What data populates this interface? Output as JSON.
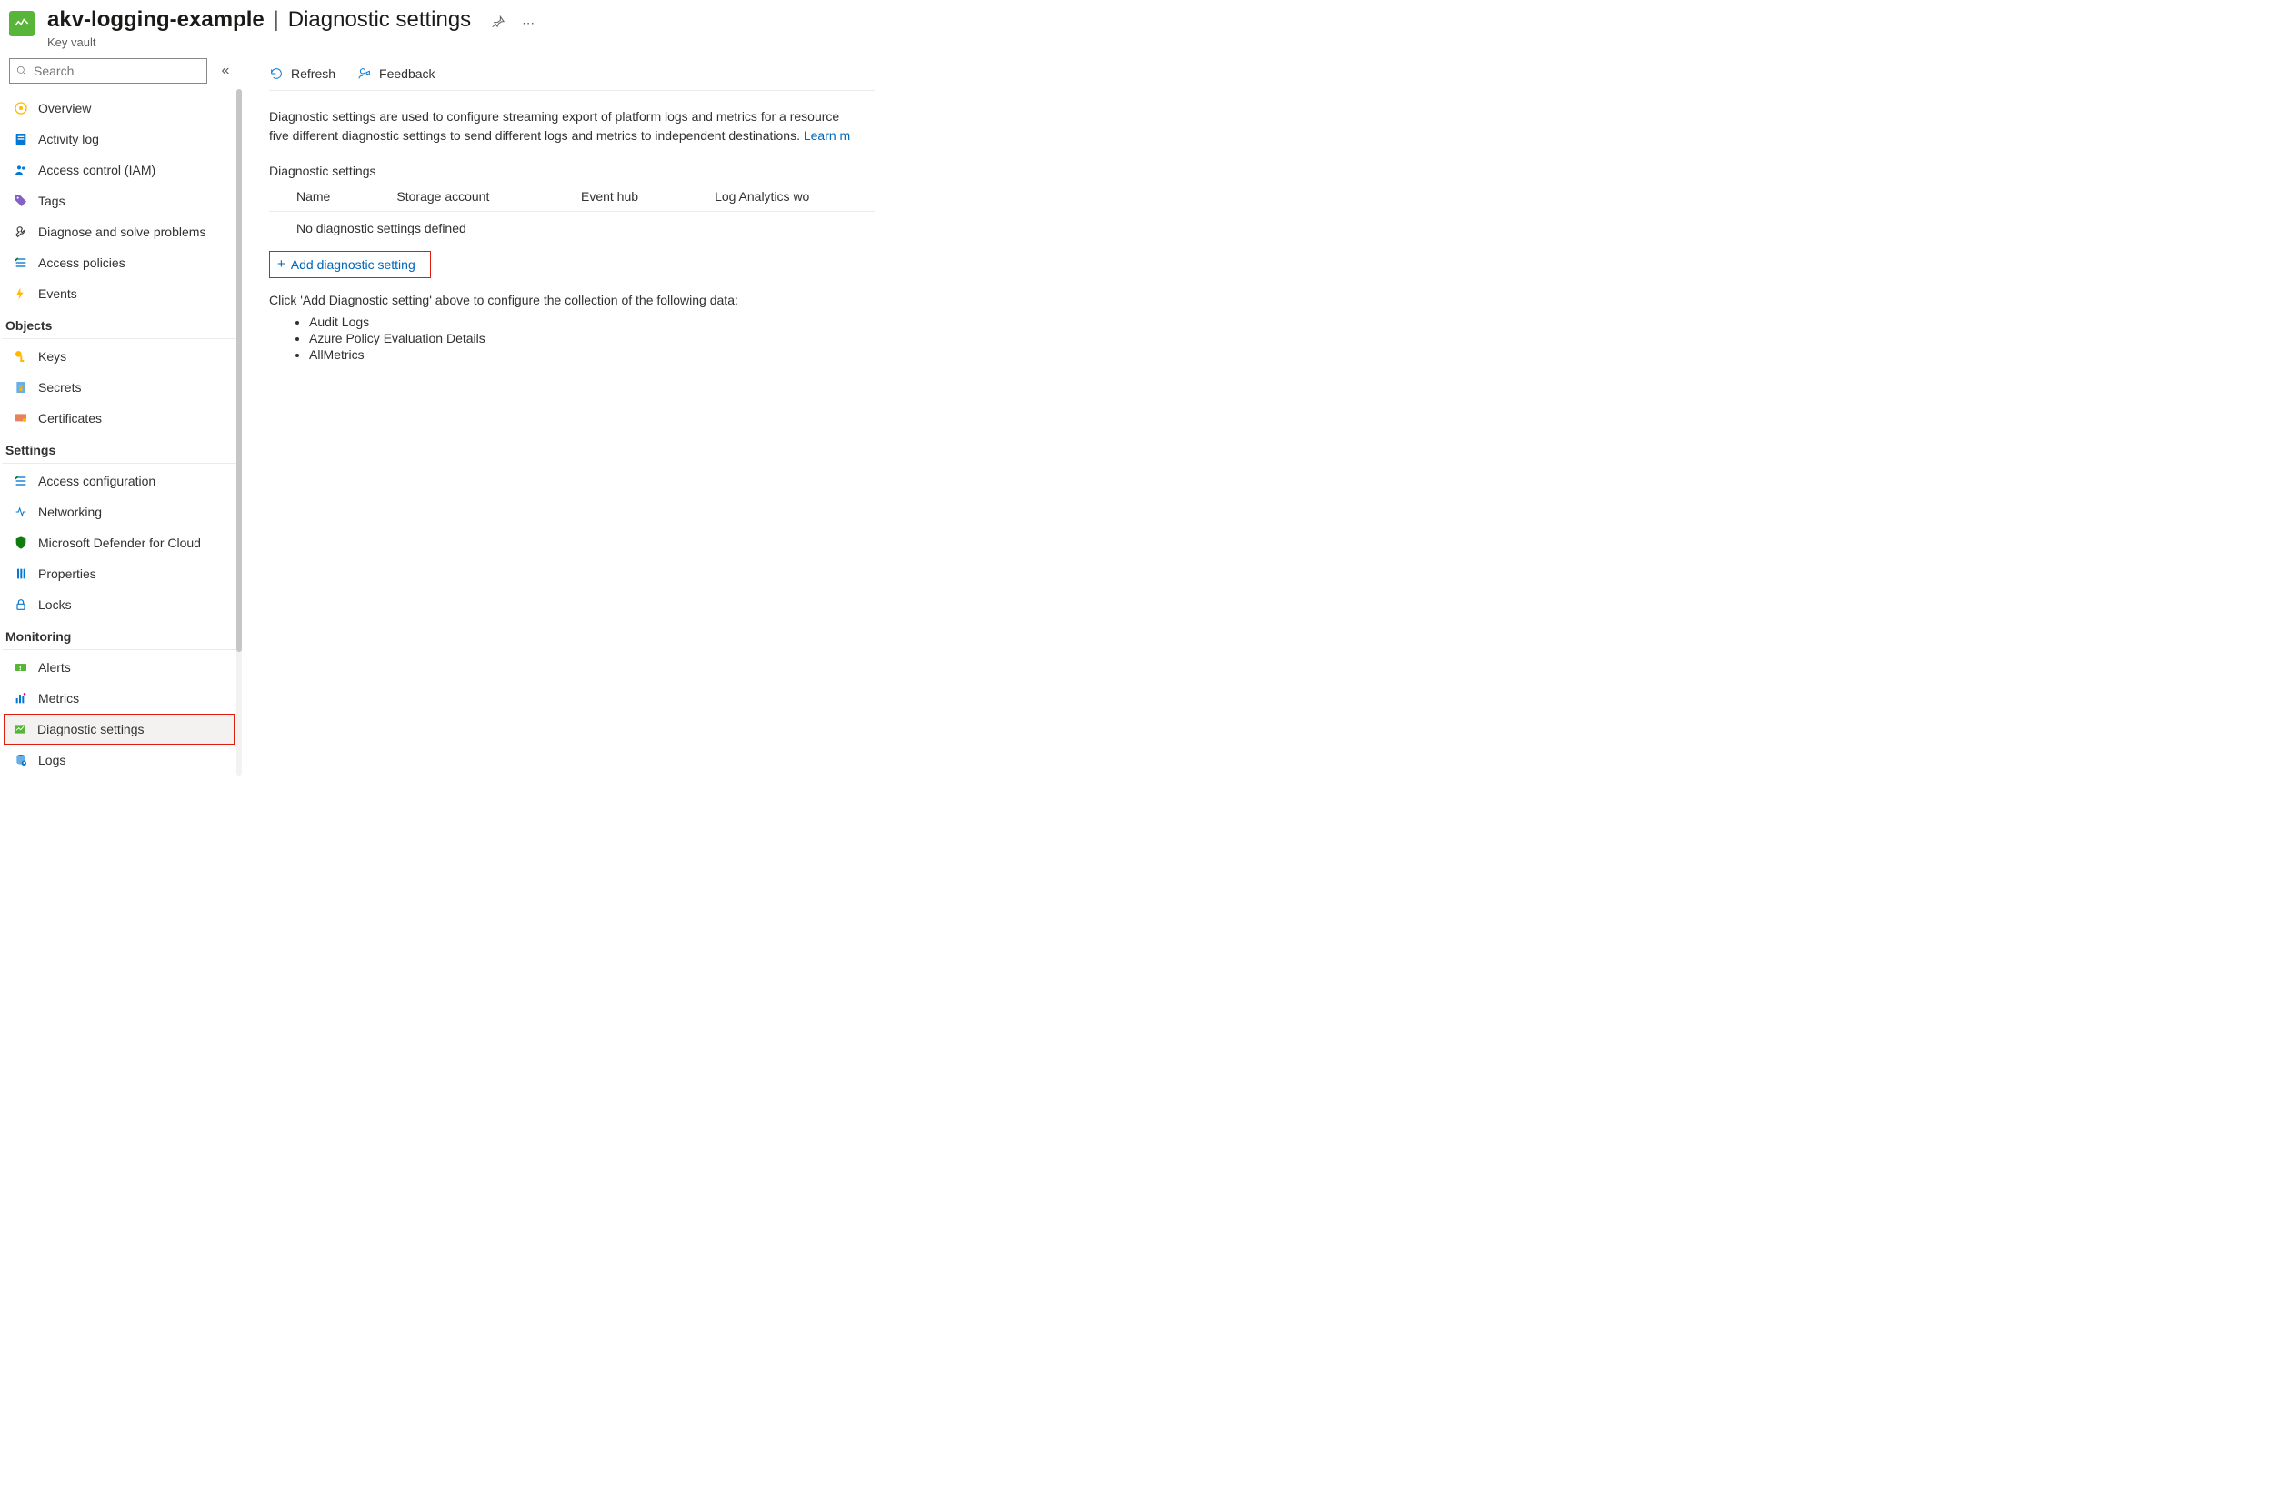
{
  "header": {
    "resource_name": "akv-logging-example",
    "page_title": "Diagnostic settings",
    "resource_type": "Key vault"
  },
  "search": {
    "placeholder": "Search"
  },
  "nav": {
    "top_items": [
      {
        "id": "overview",
        "label": "Overview"
      },
      {
        "id": "activity-log",
        "label": "Activity log"
      },
      {
        "id": "access-control",
        "label": "Access control (IAM)"
      },
      {
        "id": "tags",
        "label": "Tags"
      },
      {
        "id": "diagnose-solve",
        "label": "Diagnose and solve problems"
      },
      {
        "id": "access-policies",
        "label": "Access policies"
      },
      {
        "id": "events",
        "label": "Events"
      }
    ],
    "objects_header": "Objects",
    "objects_items": [
      {
        "id": "keys",
        "label": "Keys"
      },
      {
        "id": "secrets",
        "label": "Secrets"
      },
      {
        "id": "certificates",
        "label": "Certificates"
      }
    ],
    "settings_header": "Settings",
    "settings_items": [
      {
        "id": "access-configuration",
        "label": "Access configuration"
      },
      {
        "id": "networking",
        "label": "Networking"
      },
      {
        "id": "defender",
        "label": "Microsoft Defender for Cloud"
      },
      {
        "id": "properties",
        "label": "Properties"
      },
      {
        "id": "locks",
        "label": "Locks"
      }
    ],
    "monitoring_header": "Monitoring",
    "monitoring_items": [
      {
        "id": "alerts",
        "label": "Alerts"
      },
      {
        "id": "metrics",
        "label": "Metrics"
      },
      {
        "id": "diagnostic-settings",
        "label": "Diagnostic settings"
      },
      {
        "id": "logs",
        "label": "Logs"
      }
    ]
  },
  "toolbar": {
    "refresh_label": "Refresh",
    "feedback_label": "Feedback"
  },
  "main": {
    "description_part1": "Diagnostic settings are used to configure streaming export of platform logs and metrics for a resource",
    "description_part2": "five different diagnostic settings to send different logs and metrics to independent destinations. ",
    "learn_more": "Learn m",
    "section_label": "Diagnostic settings",
    "table": {
      "col_name": "Name",
      "col_storage": "Storage account",
      "col_eventhub": "Event hub",
      "col_law": "Log Analytics wo",
      "empty_row": "No diagnostic settings defined"
    },
    "add_label": "Add diagnostic setting",
    "click_desc": "Click 'Add Diagnostic setting' above to configure the collection of the following data:",
    "data_types": [
      "Audit Logs",
      "Azure Policy Evaluation Details",
      "AllMetrics"
    ]
  }
}
